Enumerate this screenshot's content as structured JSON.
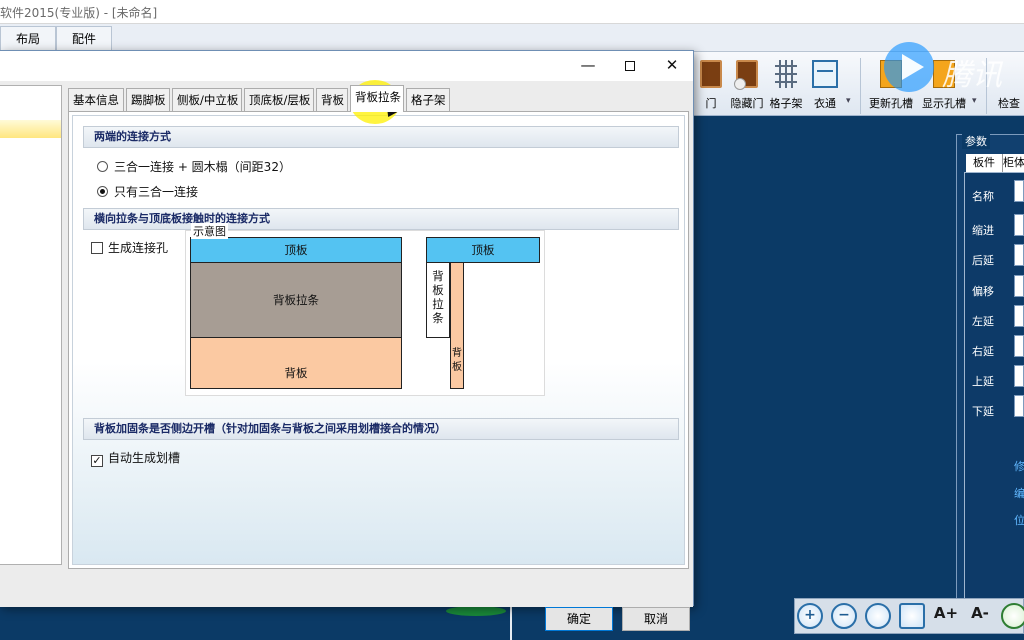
{
  "app": {
    "title": "软件2015(专业版) - [未命名]"
  },
  "menu": {
    "items": [
      "布局",
      "配件"
    ]
  },
  "ribbon": {
    "buttons": [
      "门",
      "隐藏门",
      "格子架",
      "衣通",
      "更新孔槽",
      "显示孔槽",
      "检查"
    ]
  },
  "watermark": {
    "text": "腾讯"
  },
  "params": {
    "legend": "参数",
    "tabs": [
      "板件",
      "柜体"
    ],
    "rows": [
      "名称",
      "缩进",
      "后延",
      "偏移",
      "左延",
      "右延",
      "上延",
      "下延"
    ],
    "links": [
      "修",
      "编",
      "位"
    ]
  },
  "bottom_toolbar": {
    "zoom_in": "+",
    "zoom_out": "−",
    "font_up": "A+",
    "font_down": "A-"
  },
  "dialog": {
    "controls": {
      "minimize": "—",
      "close": "✕"
    },
    "tabs": [
      "基本信息",
      "踢脚板",
      "侧板/中立板",
      "顶底板/层板",
      "背板",
      "背板拉条",
      "格子架"
    ],
    "active_tab": "背板拉条",
    "section1": {
      "title": "两端的连接方式",
      "option1": "三合一连接 + 圆木榻（间距32）",
      "option2": "只有三合一连接",
      "selected": 2
    },
    "section2": {
      "title": "横向拉条与顶底板接触时的连接方式",
      "checkbox_label": "生成连接孔",
      "checked": false,
      "diagram_title": "示意图",
      "diagram": {
        "top_left": "顶板",
        "strip": "背板拉条",
        "back": "背板",
        "top_right": "顶板",
        "strip_vertical": "背\n板\n拉\n条",
        "back_vertical": "背\n板"
      }
    },
    "section3": {
      "title": "背板加固条是否侧边开槽（针对加固条与背板之间采用划槽接合的情况）",
      "checkbox_label": "自动生成划槽",
      "checked": true
    },
    "ok_label": "确定",
    "cancel_label": "取消"
  },
  "colors": {
    "workspace": "#0b3a66",
    "top_board": "#54c3f2",
    "strip": "#a79d94",
    "back_board": "#fbc9a2",
    "highlight": "#fff000"
  }
}
